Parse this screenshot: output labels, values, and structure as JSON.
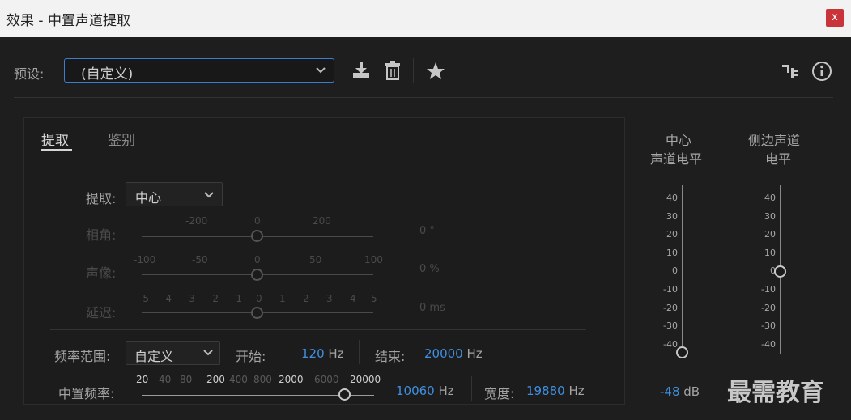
{
  "window": {
    "title": "效果 - 中置声道提取",
    "close_label": "x"
  },
  "toolbar": {
    "preset_label": "预设:",
    "preset_value": "(自定义)"
  },
  "tabs": [
    {
      "label": "提取",
      "active": true
    },
    {
      "label": "鉴别",
      "active": false
    }
  ],
  "extract": {
    "label": "提取:",
    "value": "中心"
  },
  "phase": {
    "label": "相角:",
    "ticks": [
      "-200",
      "0",
      "200"
    ],
    "value": "0",
    "unit": "°"
  },
  "image": {
    "label": "声像:",
    "ticks": [
      "-100",
      "-50",
      "0",
      "50",
      "100"
    ],
    "value": "0",
    "unit": "%"
  },
  "delay": {
    "label": "延迟:",
    "ticks": [
      "-5",
      "-4",
      "-3",
      "-2",
      "-1",
      "0",
      "1",
      "2",
      "3",
      "4",
      "5"
    ],
    "value": "0",
    "unit": "ms"
  },
  "freq_range": {
    "label": "频率范围:",
    "value": "自定义",
    "start_label": "开始:",
    "start_value": "120",
    "start_unit": "Hz",
    "end_label": "结束:",
    "end_value": "20000",
    "end_unit": "Hz"
  },
  "center_freq": {
    "label": "中置频率:",
    "ticks": [
      "20",
      "40",
      "80",
      "200",
      "400",
      "800",
      "2000",
      "6000",
      "20000"
    ],
    "value": "10060",
    "unit": "Hz",
    "width_label": "宽度:",
    "width_value": "19880",
    "width_unit": "Hz"
  },
  "meters": {
    "center": {
      "title_line1": "中心",
      "title_line2": "声道电平",
      "value": "-48",
      "unit": "dB",
      "level": -48
    },
    "side": {
      "title_line1": "侧边声道",
      "title_line2": "电平",
      "level": 0
    },
    "scale": [
      "40",
      "30",
      "20",
      "10",
      "0",
      "-10",
      "-20",
      "-30",
      "-40"
    ]
  },
  "watermark": "最需教育",
  "colors": {
    "accent": "#3f8fe0",
    "close": "#c9343a"
  }
}
